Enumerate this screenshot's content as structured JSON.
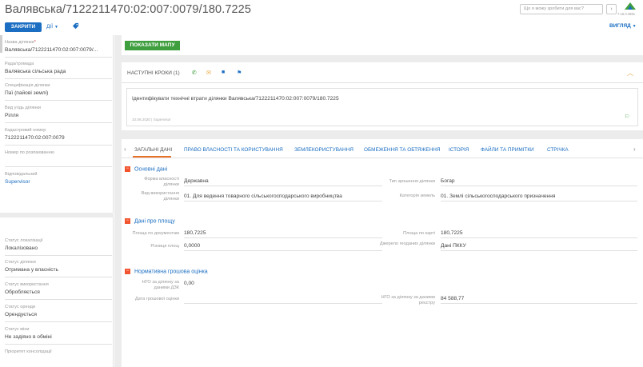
{
  "header": {
    "title": "Валявська/7122211470:02:007:0079/180.7225",
    "close_label": "ЗАКРИТИ",
    "actions_label": "ДІЇ",
    "search_placeholder": "Що я можу зробити для вас?",
    "version": "7.16.0.4861",
    "view_label": "ВИГЛЯД"
  },
  "sidebar": {
    "plot_name_label": "Назва ділянки",
    "plot_name_value": "Валявська/7122211470:02:007:0079/...",
    "council_label": "Рада/громада",
    "council_value": "Валявська сільська рада",
    "spec_label": "Специфікація ділянки",
    "spec_value": "Паї (пайові землі)",
    "land_type_label": "Вид угідь ділянки",
    "land_type_value": "Рілля",
    "cadastre_label": "Кадастровий номер",
    "cadastre_value": "7122211470:02:007:0079",
    "consolidation_label": "Номер по розпаюванню",
    "consolidation_value": "",
    "responsible_label": "Відповідальний",
    "responsible_value": "Supervisor",
    "loc_status_label": "Статус локалізації",
    "loc_status_value": "Локалізовано",
    "plot_status_label": "Статус ділянки",
    "plot_status_value": "Отримана у власність",
    "usage_status_label": "Статус використання",
    "usage_status_value": "Обробляється",
    "rent_status_label": "Статус оренди",
    "rent_status_value": "Орендується",
    "exchange_status_label": "Статус міни",
    "exchange_status_value": "Не задіяно в обміні",
    "priority_label": "Пріоритет консолідації"
  },
  "map_button": "ПОКАЗАТИ МАПУ",
  "next_steps": {
    "title": "НАСТУПНІ КРОКИ (1)",
    "task_text": "Ідентифікувати технічні втрати ділянки Валявська/7122211470:02:007:0079/180.7225",
    "task_date": "10.06.2020",
    "task_owner": "Supervisor"
  },
  "tabs": [
    {
      "label": "ЗАГАЛЬНІ ДАНІ"
    },
    {
      "label": "ПРАВО ВЛАСНОСТІ ТА КОРИСТУВАННЯ"
    },
    {
      "label": "ЗЕМЛЕКОРИСТУВАННЯ"
    },
    {
      "label": "ОБМЕЖЕННЯ ТА ОБТЯЖЕННЯ"
    },
    {
      "label": "ІСТОРІЯ"
    },
    {
      "label": "ФАЙЛИ ТА ПРИМІТКИ"
    },
    {
      "label": "СТРІЧКА"
    }
  ],
  "basic": {
    "title": "Основні дані",
    "ownership_label": "Форма власності ділянки",
    "ownership_value": "Державна",
    "irrigation_label": "Тип зрошення ділянки",
    "irrigation_value": "Богар",
    "purpose_label": "Вид використання ділянки",
    "purpose_value": "01. Для ведення товарного сільськогосподарського виробництва",
    "category_label": "Категорія земель",
    "category_value": "01. Землі сільськогосподарського призначення"
  },
  "area": {
    "title": "Дані про площу",
    "doc_area_label": "Площа по документам",
    "doc_area_value": "180,7225",
    "map_area_label": "Площа по карті",
    "map_area_value": "180,7225",
    "diff_label": "Різниця площ",
    "diff_value": "0,0000",
    "source_label": "Джерело геоданих ділянки",
    "source_value": "Дані ПККУ"
  },
  "valuation": {
    "title": "Нормативна грошова оцінка",
    "ngo_dzk_label": "НГО за ділянку за даними ДЗК",
    "ngo_dzk_value": "0,00",
    "date_label": "Дата грошової оцінки",
    "date_value": "",
    "ngo_reg_label": "НГО за ділянку за даними реєстру",
    "ngo_reg_value": "84 588,77"
  },
  "colors": {
    "primary": "#1b6ec2",
    "green": "#3f9f3f",
    "orange": "#e8722a",
    "section_marker": "#f1542e"
  }
}
